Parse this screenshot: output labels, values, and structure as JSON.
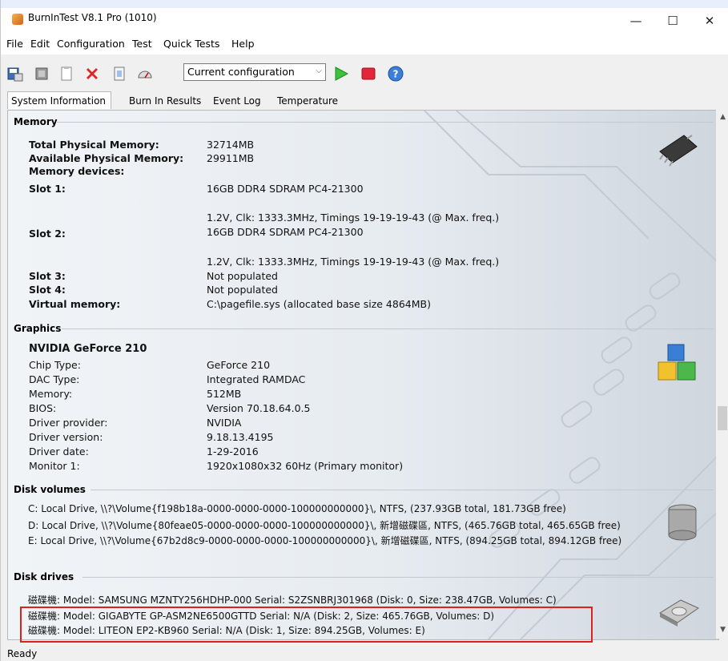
{
  "window": {
    "title": "BurnInTest V8.1 Pro (1010)",
    "minimize": "—",
    "maximize": "☐",
    "close": "✕"
  },
  "menu": [
    "File",
    "Edit",
    "Configuration",
    "Test",
    "Quick Tests",
    "Help"
  ],
  "toolbar": {
    "icons": [
      "save-icon",
      "cpu-icon",
      "clipboard-icon",
      "stop-x-icon",
      "test-icon",
      "gauge-icon",
      "play-icon",
      "stop-icon",
      "help-icon"
    ],
    "config_value": "Current configuration",
    "config_arrow": "⌵"
  },
  "tabs": [
    "System Information",
    "Burn In Results",
    "Event Log",
    "Temperature"
  ],
  "memory": {
    "heading": "Memory",
    "total_label": "Total Physical Memory:",
    "total_value": "32714MB",
    "available_label": "Available Physical Memory:",
    "available_value": "29911MB",
    "devices_label": "Memory devices:",
    "slot1_label": "Slot 1:",
    "slot1_value": "16GB DDR4 SDRAM PC4-21300",
    "slot1_detail": "1.2V, Clk: 1333.3MHz, Timings 19-19-19-43 (@ Max. freq.)",
    "slot2_label": "Slot 2:",
    "slot2_value": "16GB DDR4 SDRAM PC4-21300",
    "slot2_detail": "1.2V, Clk: 1333.3MHz, Timings 19-19-19-43 (@ Max. freq.)",
    "slot3_label": "Slot 3:",
    "slot3_value": "Not populated",
    "slot4_label": "Slot 4:",
    "slot4_value": "Not populated",
    "virtual_label": "Virtual memory:",
    "virtual_value": "C:\\pagefile.sys (allocated base size 4864MB)"
  },
  "graphics": {
    "heading": "Graphics",
    "card": "NVIDIA GeForce 210",
    "rows": [
      {
        "label": "Chip Type:",
        "value": "GeForce 210"
      },
      {
        "label": "DAC Type:",
        "value": "Integrated RAMDAC"
      },
      {
        "label": "Memory:",
        "value": "512MB"
      },
      {
        "label": "BIOS:",
        "value": "Version 70.18.64.0.5"
      },
      {
        "label": "Driver provider:",
        "value": "NVIDIA"
      },
      {
        "label": "Driver version:",
        "value": "9.18.13.4195"
      },
      {
        "label": "Driver date:",
        "value": "1-29-2016"
      },
      {
        "label": "Monitor 1:",
        "value": "1920x1080x32 60Hz (Primary monitor)"
      }
    ]
  },
  "volumes": {
    "heading": "Disk volumes",
    "rows": [
      "C:  Local Drive, \\\\?\\Volume{f198b18a-0000-0000-0000-100000000000}\\, NTFS, (237.93GB total, 181.73GB free)",
      "D:  Local Drive, \\\\?\\Volume{80feae05-0000-0000-0000-100000000000}\\, 新增磁碟區, NTFS, (465.76GB total, 465.65GB free)",
      "E:  Local Drive, \\\\?\\Volume{67b2d8c9-0000-0000-0000-100000000000}\\, 新增磁碟區, NTFS, (894.25GB total, 894.12GB free)"
    ]
  },
  "drives": {
    "heading": "Disk drives",
    "rows": [
      "磁碟機: Model: SAMSUNG MZNTY256HDHP-000 Serial: S2ZSNBRJ301968 (Disk: 0, Size: 238.47GB, Volumes: C)",
      "磁碟機: Model: GIGABYTE GP-ASM2NE6500GTTD Serial: N/A (Disk: 2, Size: 465.76GB, Volumes: D)",
      "磁碟機: Model: LITEON EP2-KB960 Serial: N/A (Disk: 1, Size: 894.25GB, Volumes: E)"
    ]
  },
  "status": "Ready",
  "colors": {
    "highlight_box": "#e02020",
    "panel_bg": "#e9edf1"
  }
}
